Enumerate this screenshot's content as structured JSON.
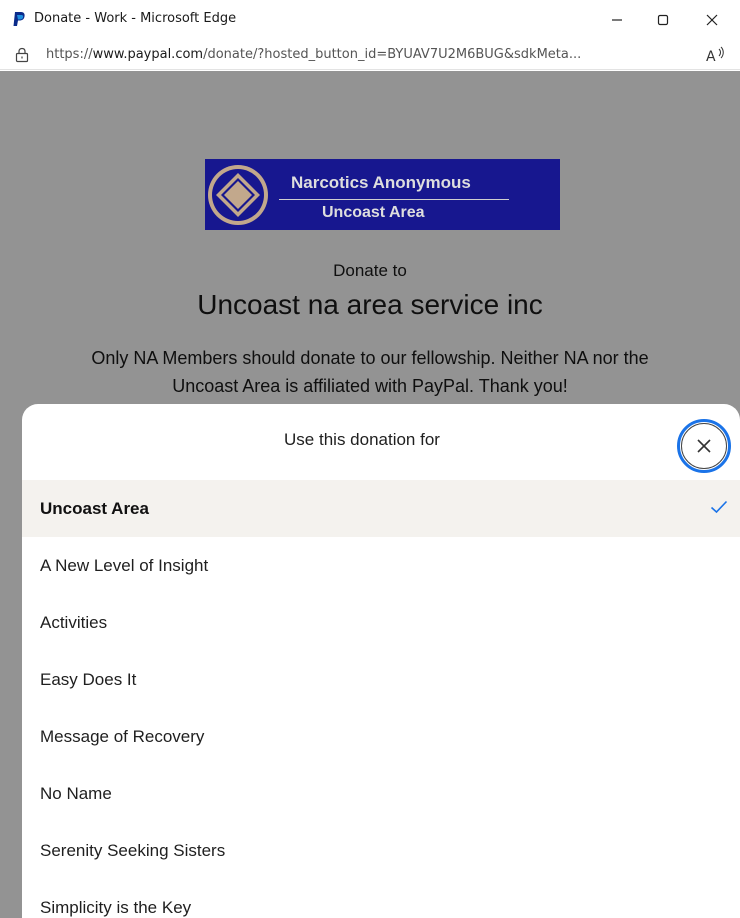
{
  "window": {
    "title": "Donate - Work - Microsoft Edge",
    "url_prefix": "https://",
    "url_domain": "www.paypal.com",
    "url_path": "/donate/?hosted_button_id=BYUAV7U2M6BUG&sdkMeta...",
    "read_aloud_icon": "read-aloud-icon"
  },
  "banner": {
    "title": "Narcotics Anonymous",
    "subtitle": "Uncoast Area"
  },
  "page": {
    "donate_to": "Donate to",
    "org_name": "Uncoast na area service inc",
    "description": "Only NA Members should donate to our fellowship. Neither NA nor the Uncoast Area is affiliated with PayPal. Thank you!"
  },
  "sheet": {
    "title": "Use this donation for",
    "options": [
      {
        "label": "Uncoast Area",
        "selected": true
      },
      {
        "label": "A New Level of Insight",
        "selected": false
      },
      {
        "label": "Activities",
        "selected": false
      },
      {
        "label": "Easy Does It",
        "selected": false
      },
      {
        "label": "Message of Recovery",
        "selected": false
      },
      {
        "label": "No Name",
        "selected": false
      },
      {
        "label": "Serenity Seeking Sisters",
        "selected": false
      },
      {
        "label": "Simplicity is the Key",
        "selected": false
      }
    ]
  },
  "colors": {
    "accent": "#1a73e8",
    "banner_bg": "#17178f",
    "overlay": "#939393",
    "selected_bg": "#f4f2ee"
  }
}
